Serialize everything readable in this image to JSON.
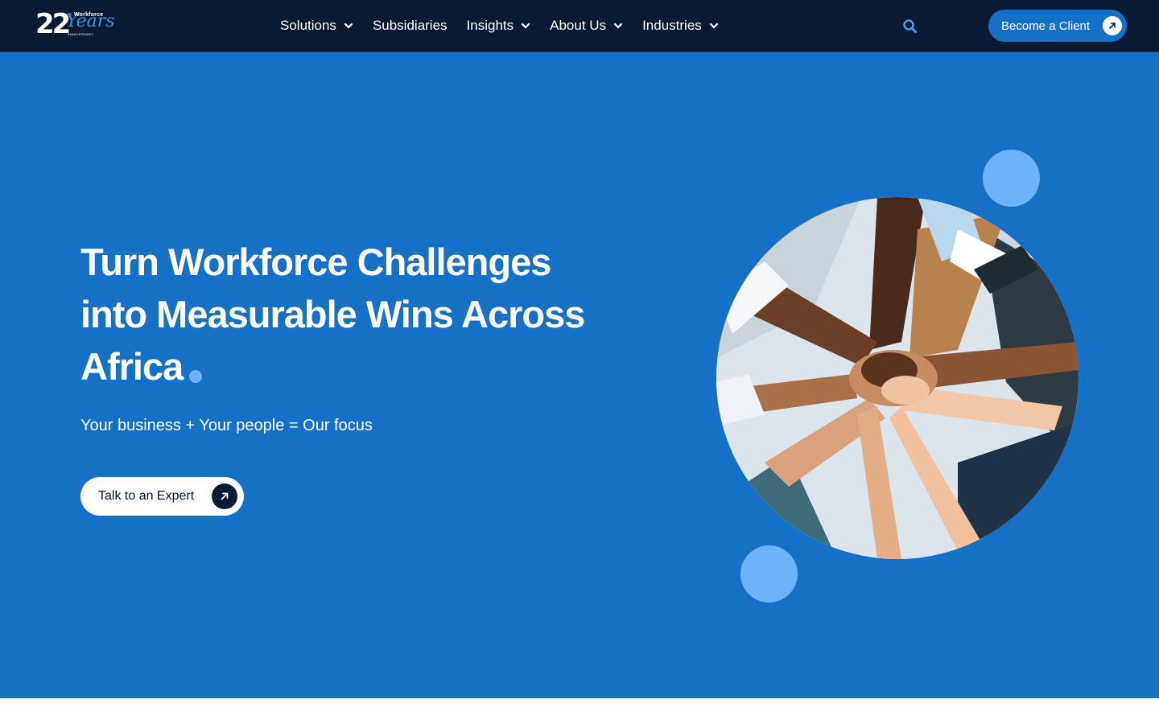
{
  "header": {
    "logo": {
      "number": "22",
      "script": "Years",
      "brand": "Workforce",
      "caption": "ANNIVERSARY"
    },
    "nav": [
      {
        "label": "Solutions",
        "has_dropdown": true
      },
      {
        "label": "Subsidiaries",
        "has_dropdown": false
      },
      {
        "label": "Insights",
        "has_dropdown": true
      },
      {
        "label": "About Us",
        "has_dropdown": true
      },
      {
        "label": "Industries",
        "has_dropdown": true
      }
    ],
    "search_icon": "search-icon",
    "cta_label": "Become a Client"
  },
  "hero": {
    "headline_line1": "Turn Workforce Challenges",
    "headline_line2": "into Measurable Wins Across",
    "headline_line3": "Africa",
    "subheadline": "Your business + Your people = Our focus",
    "cta_label": "Talk to an Expert",
    "image_icon": "team-hands-photo"
  },
  "colors": {
    "nav_bg": "#0a1a33",
    "hero_bg": "#1570c6",
    "accent_light": "#6eb2f7",
    "white": "#ffffff"
  }
}
